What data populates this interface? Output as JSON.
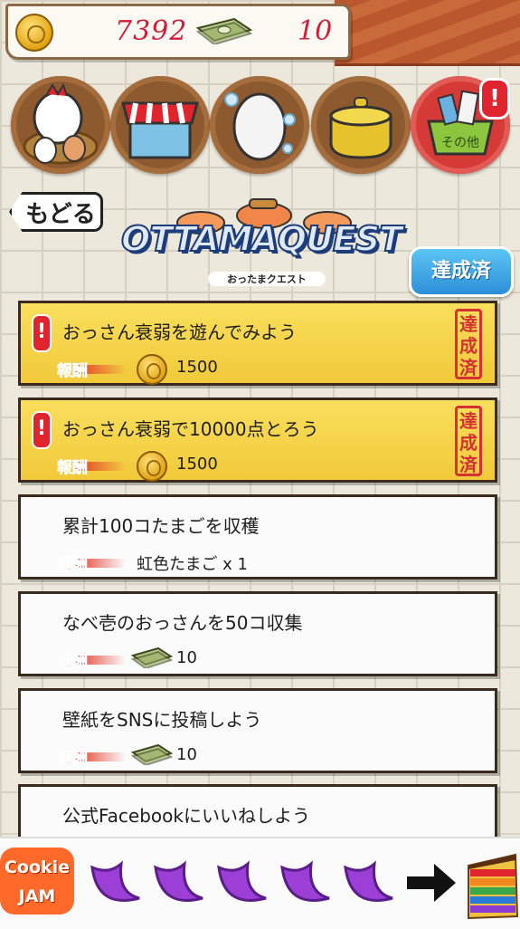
{
  "header": {
    "coins": "7392",
    "bills": "10"
  },
  "top_icons": [
    {
      "name": "nest-icon"
    },
    {
      "name": "shop-icon"
    },
    {
      "name": "egg-icon"
    },
    {
      "name": "pot-icon"
    },
    {
      "name": "other-icon",
      "label": "その他"
    }
  ],
  "nav": {
    "back_label": "もどる",
    "done_label": "達成済"
  },
  "logo": {
    "title": "OTTAMAQUEST",
    "subtitle": "おったまクエスト"
  },
  "reward_label": "報酬",
  "stamp_text": "達成済",
  "quests": [
    {
      "title": "おっさん衰弱を遊んでみよう",
      "reward_type": "coin",
      "reward": "1500",
      "achieved": true
    },
    {
      "title": "おっさん衰弱で10000点とろう",
      "reward_type": "coin",
      "reward": "1500",
      "achieved": true
    },
    {
      "title": "累計100コたまごを収穫",
      "reward_type": "text",
      "reward": "虹色たまご x 1",
      "achieved": false
    },
    {
      "title": "なべ壱のおっさんを50コ収集",
      "reward_type": "bills",
      "reward": "10",
      "achieved": false
    },
    {
      "title": "壁紙をSNSに投稿しよう",
      "reward_type": "bills",
      "reward": "10",
      "achieved": false
    },
    {
      "title": "公式Facebookにいいねしよう",
      "reward_type": "none",
      "reward": "",
      "achieved": false
    }
  ],
  "ad": {
    "brand_line1": "Cookie",
    "brand_line2": "JAM"
  },
  "colors": {
    "accent_red": "#d21d3a",
    "achieved_yellow": "#f1c93a",
    "button_blue": "#2b8fd8"
  }
}
